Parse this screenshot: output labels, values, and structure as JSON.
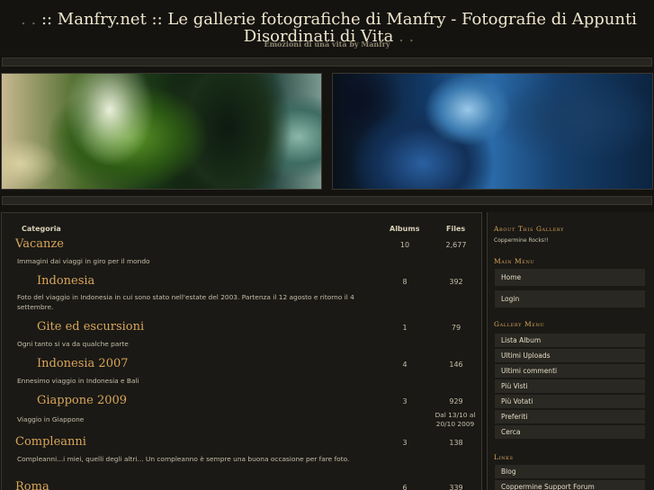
{
  "header": {
    "title_dots": ". . ",
    "title": ":: Manfry.net :: Le gallerie fotografiche di Manfry - Fotografie di Appunti Disordinati di Vita",
    "title_dots_end": " . .",
    "subtitle": "Emozioni di una vita by Manfry"
  },
  "table": {
    "headers": {
      "category": "Categoria",
      "albums": "Albums",
      "files": "Files"
    },
    "rows": [
      {
        "title": "Vacanze",
        "description": "Immagini dai viaggi in giro per il mondo",
        "albums": "10",
        "files": "2,677"
      },
      {
        "title": "Indonesia",
        "description": "Foto del viaggio in Indonesia in cui sono stato nell'estate del 2003. Partenza il 12 agosto e ritorno il 4 settembre.",
        "albums": "8",
        "files": "392"
      },
      {
        "title": "Gite ed escursioni",
        "description": "Ogni tanto si va da qualche parte",
        "albums": "1",
        "files": "79"
      },
      {
        "title": "Indonesia 2007",
        "description": "Ennesimo viaggio in Indonesia e Bali",
        "albums": "4",
        "files": "146"
      },
      {
        "title": "Giappone 2009",
        "description": "Viaggio in Giappone",
        "albums": "3",
        "files": "929",
        "files_note": "Dal 13/10 al 20/10 2009"
      },
      {
        "title": "Compleanni",
        "description": "Compleanni...i miei, quelli degli altri... Un compleanno è sempre una buona occasione per fare foto.",
        "albums": "3",
        "files": "138"
      },
      {
        "title": "Roma",
        "description": "",
        "albums": "6",
        "files": "339"
      }
    ]
  },
  "sidebar": {
    "about_heading": "About This Gallery",
    "about_text": "Coppermine Rocks!!",
    "main_menu_heading": "Main Menu",
    "main_menu": [
      "Home",
      "Login"
    ],
    "gallery_menu_heading": "Gallery Menu",
    "gallery_menu": [
      "Lista Album",
      "Ultimi Uploads",
      "Ultimi commenti",
      "Più Visti",
      "Più Votati",
      "Preferiti",
      "Cerca"
    ],
    "links_heading": "Links",
    "links": [
      "Blog",
      "Coppermine Support Forum"
    ]
  }
}
